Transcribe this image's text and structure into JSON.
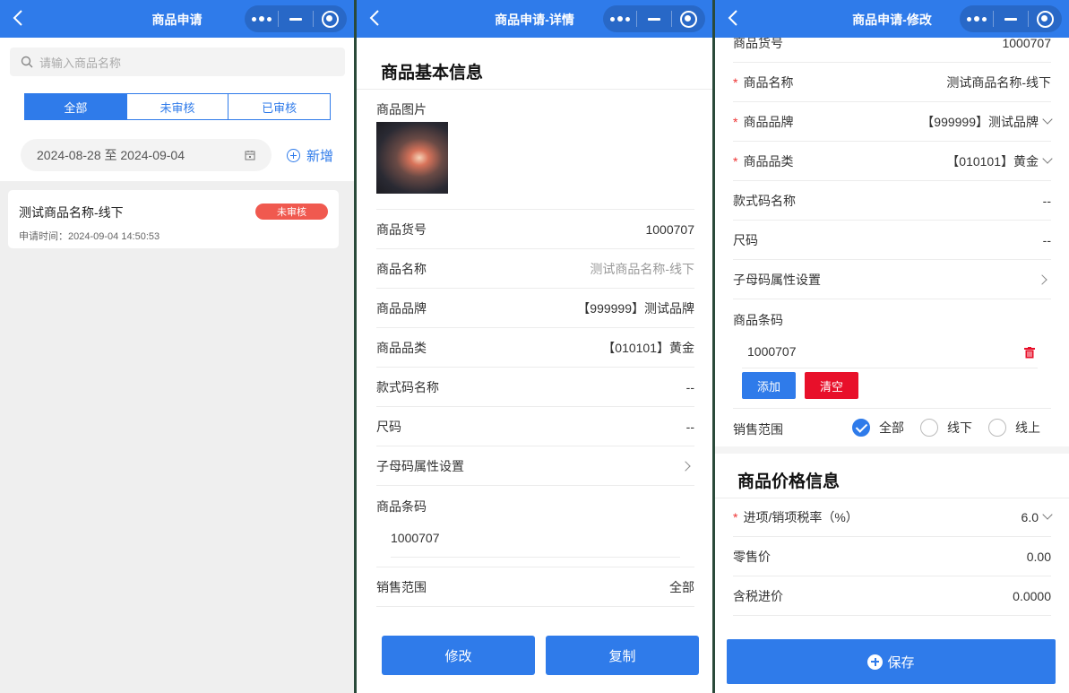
{
  "capsule": {
    "more_icon": "more-dots-icon",
    "minimize_icon": "minimize-icon",
    "close_icon": "target-icon"
  },
  "list_page": {
    "title": "商品申请",
    "search_placeholder": "请输入商品名称",
    "tabs": [
      {
        "label": "全部",
        "active": true
      },
      {
        "label": "未审核",
        "active": false
      },
      {
        "label": "已审核",
        "active": false
      }
    ],
    "date_range": "2024-08-28 至 2024-09-04",
    "add_label": "新增",
    "items": [
      {
        "name": "测试商品名称-线下",
        "time": "申请时间：2024-09-04 14:50:53",
        "status": "未审核"
      }
    ]
  },
  "detail_page": {
    "title": "商品申请-详情",
    "section_title": "商品基本信息",
    "image_label": "商品图片",
    "rows": [
      {
        "label": "商品货号",
        "value": "1000707"
      },
      {
        "label": "商品名称",
        "value": "测试商品名称-线下"
      },
      {
        "label": "商品品牌",
        "value": "【999999】测试品牌"
      },
      {
        "label": "商品品类",
        "value": "【010101】黄金"
      },
      {
        "label": "款式码名称",
        "value": "--"
      },
      {
        "label": "尺码",
        "value": "--"
      },
      {
        "label": "子母码属性设置",
        "value": ""
      }
    ],
    "barcode_label": "商品条码",
    "barcode_value": "1000707",
    "sale_label": "销售范围",
    "sale_value": "全部",
    "edit_button": "修改",
    "copy_button": "复制"
  },
  "edit_page": {
    "title": "商品申请-修改",
    "partial_row": {
      "label": "商品货号",
      "value": "1000707"
    },
    "rows": [
      {
        "label": "商品名称",
        "value": "测试商品名称-线下",
        "required": true,
        "dropdown": false
      },
      {
        "label": "商品品牌",
        "value": "【999999】测试品牌",
        "required": true,
        "dropdown": true
      },
      {
        "label": "商品品类",
        "value": "【010101】黄金",
        "required": true,
        "dropdown": true
      },
      {
        "label": "款式码名称",
        "value": "--",
        "required": false,
        "dropdown": false
      },
      {
        "label": "尺码",
        "value": "--",
        "required": false,
        "dropdown": false
      }
    ],
    "submenu_label": "子母码属性设置",
    "barcode_label": "商品条码",
    "barcode_value": "1000707",
    "add_button": "添加",
    "clear_button": "清空",
    "sale_label": "销售范围",
    "sale_options": [
      {
        "label": "全部",
        "checked": true
      },
      {
        "label": "线下",
        "checked": false
      },
      {
        "label": "线上",
        "checked": false
      }
    ],
    "price_section_title": "商品价格信息",
    "tax_label": "进项/销项税率（%）",
    "tax_value": "6.0",
    "retail_label": "零售价",
    "retail_value": "0.00",
    "cost_label": "含税进价",
    "cost_value": "0.0000",
    "save_button": "保存"
  },
  "colors": {
    "primary": "#2f7bea",
    "danger": "#e8102a",
    "badge": "#f0594f"
  }
}
